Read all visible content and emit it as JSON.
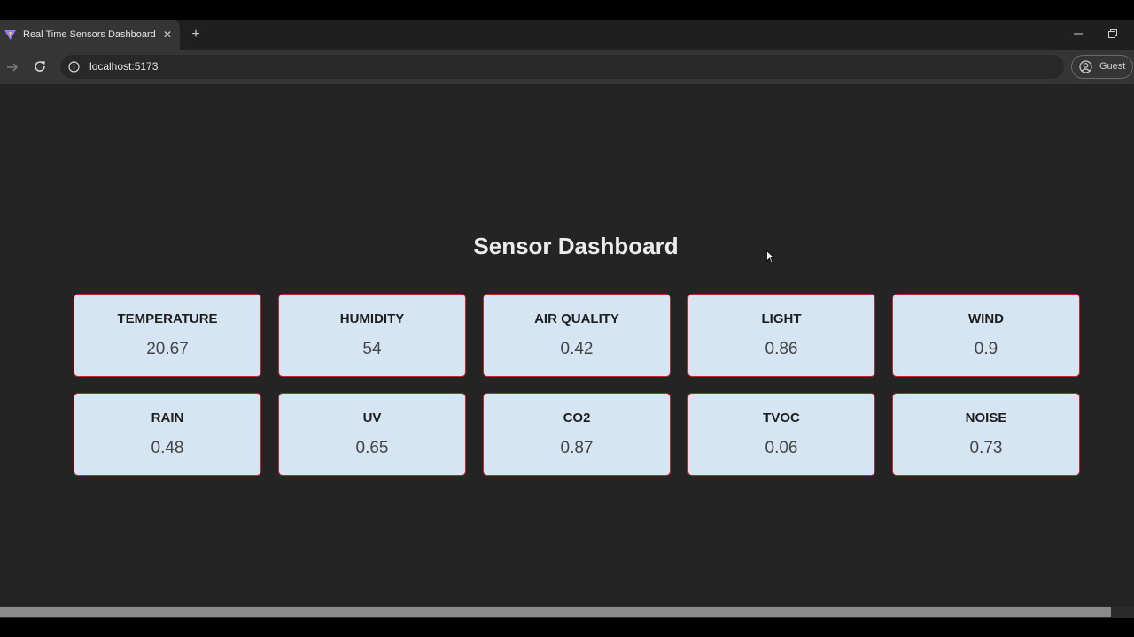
{
  "browser": {
    "tab_title": "Real Time Sensors Dashboard",
    "tab_close": "✕",
    "new_tab": "+",
    "url": "localhost:5173",
    "profile_label": "Guest"
  },
  "page": {
    "title": "Sensor Dashboard"
  },
  "sensors": [
    {
      "label": "TEMPERATURE",
      "value": "20.67"
    },
    {
      "label": "HUMIDITY",
      "value": "54"
    },
    {
      "label": "AIR QUALITY",
      "value": "0.42"
    },
    {
      "label": "LIGHT",
      "value": "0.86"
    },
    {
      "label": "WIND",
      "value": "0.9"
    },
    {
      "label": "RAIN",
      "value": "0.48"
    },
    {
      "label": "UV",
      "value": "0.65"
    },
    {
      "label": "CO2",
      "value": "0.87"
    },
    {
      "label": "TVOC",
      "value": "0.06"
    },
    {
      "label": "NOISE",
      "value": "0.73"
    }
  ],
  "colors": {
    "card_background": "#d6e5f3",
    "card_border": "#c62828",
    "page_background": "#242424"
  }
}
